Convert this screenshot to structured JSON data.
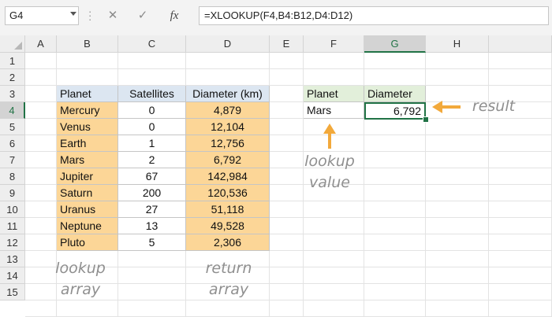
{
  "name_box": "G4",
  "formula_bar": {
    "cancel_glyph": "✕",
    "enter_glyph": "✓",
    "fx_label": "fx",
    "formula": "=XLOOKUP(F4,B4:B12,D4:D12)"
  },
  "columns": [
    "A",
    "B",
    "C",
    "D",
    "E",
    "F",
    "G",
    "H"
  ],
  "rows": [
    "1",
    "2",
    "3",
    "4",
    "5",
    "6",
    "7",
    "8",
    "9",
    "10",
    "11",
    "12",
    "13",
    "14",
    "15"
  ],
  "selected_column": "G",
  "selected_row": "4",
  "table": {
    "headers": [
      "Planet",
      "Satellites",
      "Diameter (km)"
    ],
    "rows": [
      [
        "Mercury",
        "0",
        "4,879"
      ],
      [
        "Venus",
        "0",
        "12,104"
      ],
      [
        "Earth",
        "1",
        "12,756"
      ],
      [
        "Mars",
        "2",
        "6,792"
      ],
      [
        "Jupiter",
        "67",
        "142,984"
      ],
      [
        "Saturn",
        "200",
        "120,536"
      ],
      [
        "Uranus",
        "27",
        "51,118"
      ],
      [
        "Neptune",
        "13",
        "49,528"
      ],
      [
        "Pluto",
        "5",
        "2,306"
      ]
    ]
  },
  "lookup": {
    "headers": [
      "Planet",
      "Diameter"
    ],
    "value": "Mars",
    "result": "6,792"
  },
  "annotations": {
    "result": "result",
    "lookup_value": [
      "lookup",
      "value"
    ],
    "lookup_array": [
      "lookup",
      "array"
    ],
    "return_array": [
      "return",
      "array"
    ]
  },
  "colors": {
    "header_fill": "#dce6f1",
    "array_fill": "#fcd697",
    "lookup_header_fill": "#e2efda",
    "active_border": "#217346",
    "arrow": "#f2a93b"
  }
}
